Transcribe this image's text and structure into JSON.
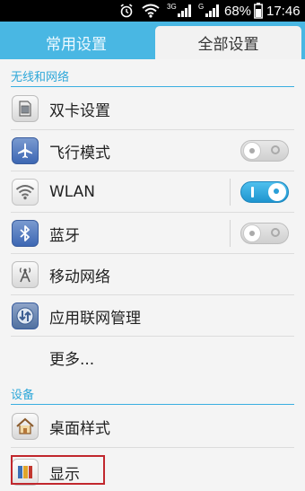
{
  "status_bar": {
    "network_3g": "3G",
    "network_g": "G",
    "battery": "68%",
    "time": "17:46"
  },
  "tabs": [
    {
      "label": "常用设置",
      "active": false
    },
    {
      "label": "全部设置",
      "active": true
    }
  ],
  "sections": {
    "wireless": {
      "header": "无线和网络",
      "items": [
        {
          "label": "双卡设置",
          "icon": "dual-sim-icon"
        },
        {
          "label": "飞行模式",
          "icon": "airplane-icon",
          "toggle": "off"
        },
        {
          "label": "WLAN",
          "icon": "wifi-icon",
          "toggle": "on"
        },
        {
          "label": "蓝牙",
          "icon": "bluetooth-icon",
          "toggle": "off"
        },
        {
          "label": "移动网络",
          "icon": "antenna-icon"
        },
        {
          "label": "应用联网管理",
          "icon": "network-arrows-icon"
        },
        {
          "label": "更多..."
        }
      ]
    },
    "device": {
      "header": "设备",
      "items": [
        {
          "label": "桌面样式",
          "icon": "home-icon"
        },
        {
          "label": "显示",
          "icon": "display-icon"
        }
      ]
    }
  },
  "colors": {
    "accent": "#49b7e3",
    "header_text": "#2da7d9",
    "toggle_on": "#1f95cf",
    "highlight": "#c1272d"
  }
}
